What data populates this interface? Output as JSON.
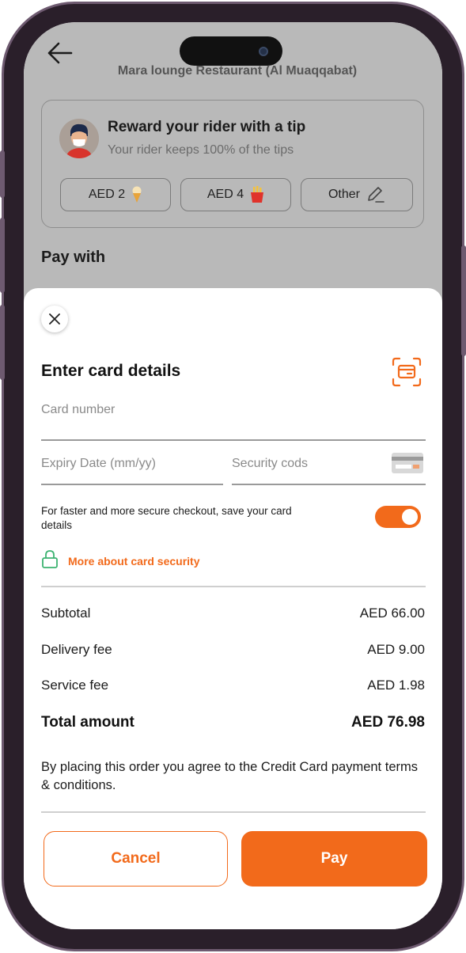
{
  "header": {
    "restaurant_name": "Mara lounge Restaurant (Al Muaqqabat)"
  },
  "tip": {
    "title": "Reward your rider with a tip",
    "subtitle": "Your rider keeps 100% of the tips",
    "options": [
      {
        "label": "AED 2",
        "icon": "ice-cream-icon"
      },
      {
        "label": "AED 4",
        "icon": "fries-icon"
      },
      {
        "label": "Other",
        "icon": "pencil-icon"
      }
    ]
  },
  "pay_with": {
    "label": "Pay with"
  },
  "card_sheet": {
    "title": "Enter card details",
    "card_number_placeholder": "Card number",
    "expiry_placeholder": "Expiry Date (mm/yy)",
    "cvv_placeholder": "Security cods",
    "save_card_text": "For faster and more secure checkout, save your card details",
    "save_card_enabled": true,
    "security_link": "More about card security"
  },
  "summary": {
    "rows": [
      {
        "label": "Subtotal",
        "value": "AED 66.00"
      },
      {
        "label": "Delivery fee",
        "value": "AED 9.00"
      },
      {
        "label": "Service fee",
        "value": "AED 1.98"
      }
    ],
    "total_label": "Total amount",
    "total_value": "AED 76.98"
  },
  "terms_text": "By placing this order you agree to the Credit Card payment terms & conditions.",
  "actions": {
    "cancel_label": "Cancel",
    "pay_label": "Pay"
  },
  "colors": {
    "accent": "#f26a1b",
    "lock": "#3cb371"
  }
}
